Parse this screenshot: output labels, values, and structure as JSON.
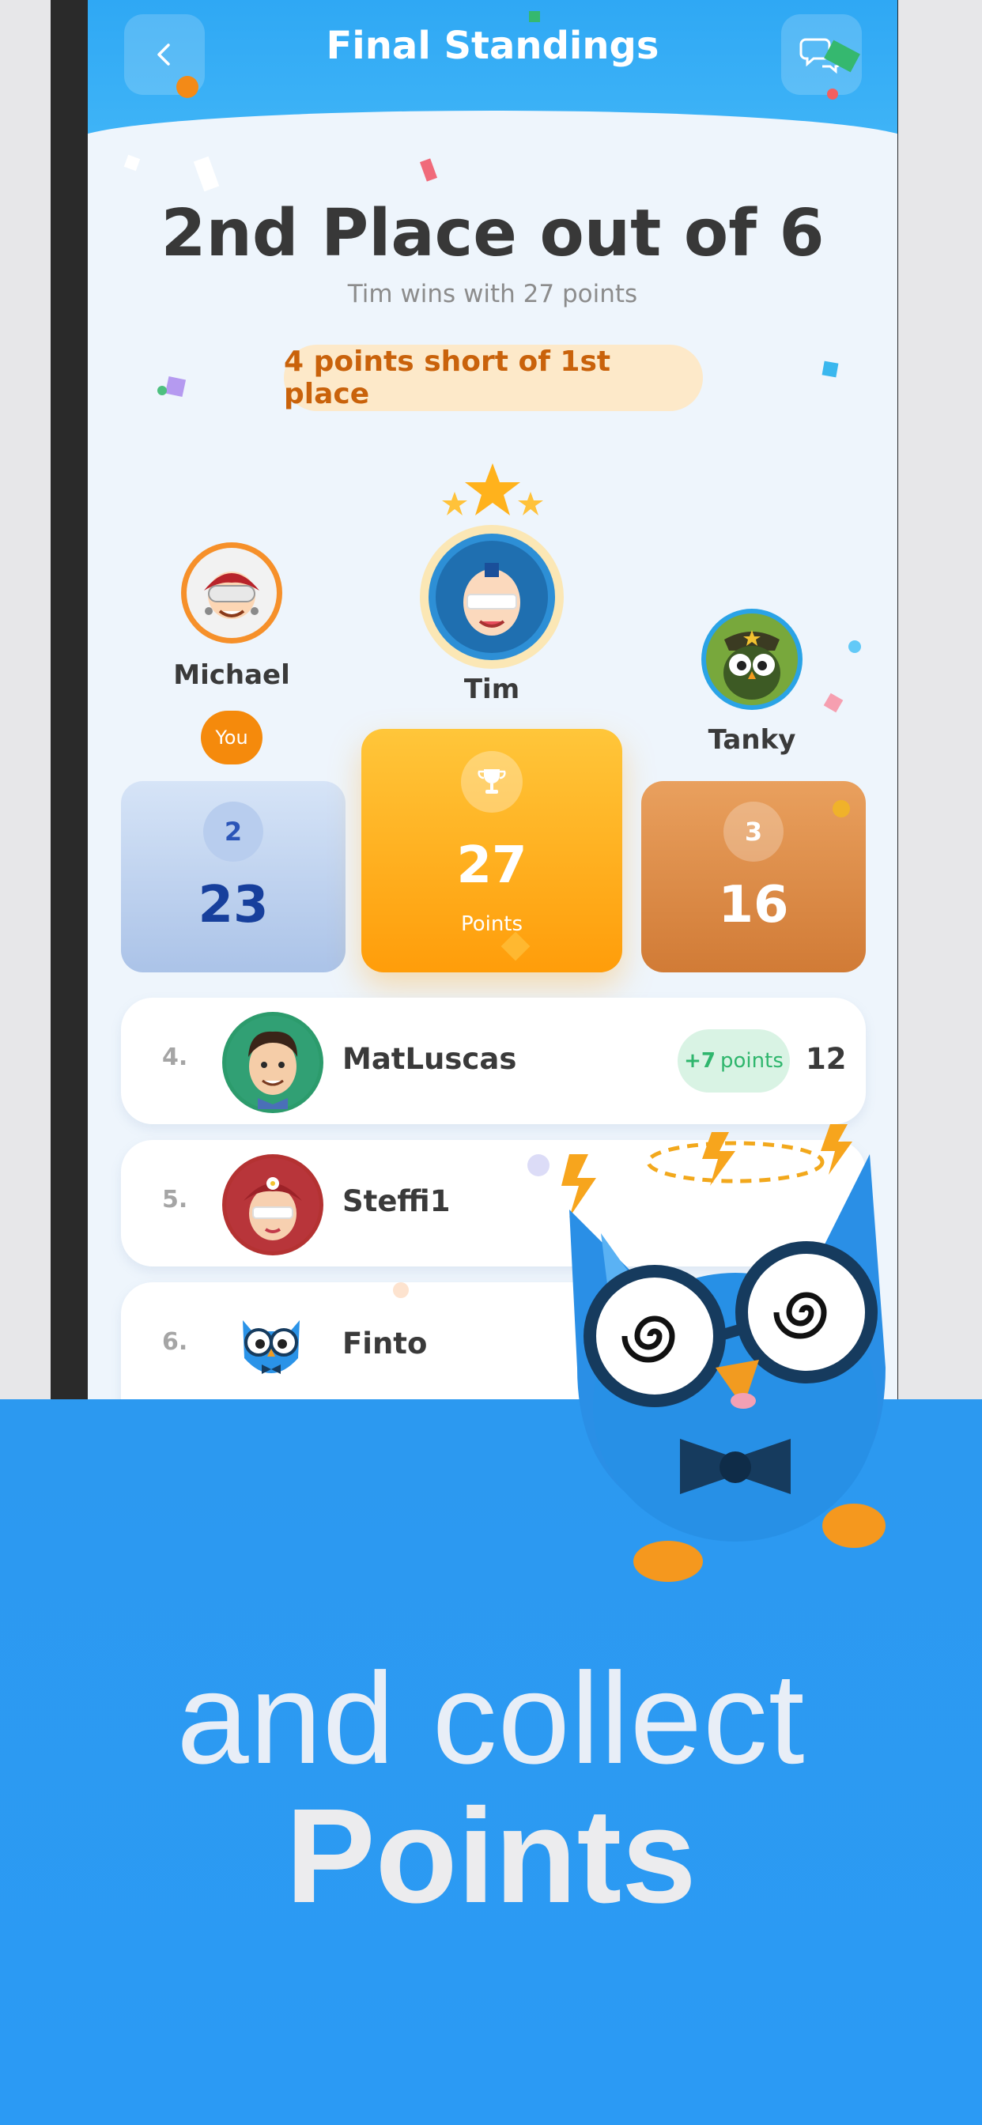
{
  "header": {
    "title": "Final Standings"
  },
  "result": {
    "headline": "2nd Place out of 6",
    "winner_note": "Tim wins with 27 points",
    "gap_note": "4 points short of 1st place"
  },
  "podium": {
    "second": {
      "name": "Michael",
      "badge": "You",
      "rank": "2",
      "points": "23"
    },
    "first": {
      "name": "Tim",
      "points": "27",
      "points_label": "Points"
    },
    "third": {
      "name": "Tanky",
      "rank": "3",
      "points": "16"
    }
  },
  "standings": [
    {
      "rank": "4.",
      "name": "MatLuscas",
      "gain": "+7",
      "gain_unit": "points",
      "points": "12"
    },
    {
      "rank": "5.",
      "name": "Steffi1"
    },
    {
      "rank": "6.",
      "name": "Finto"
    }
  ],
  "tagline": {
    "line1": "and collect",
    "line2": "Points"
  },
  "colors": {
    "accent": "#2c99f0",
    "gold": "#ffa614",
    "bronze": "#d9853f",
    "silver": "#b9cff0",
    "orange": "#f58a0c",
    "green": "#2fb66d"
  },
  "icons": [
    "back-chevron-icon",
    "chat-bubbles-icon",
    "trophy-icon",
    "star-icon",
    "owl-mascot-icon"
  ]
}
